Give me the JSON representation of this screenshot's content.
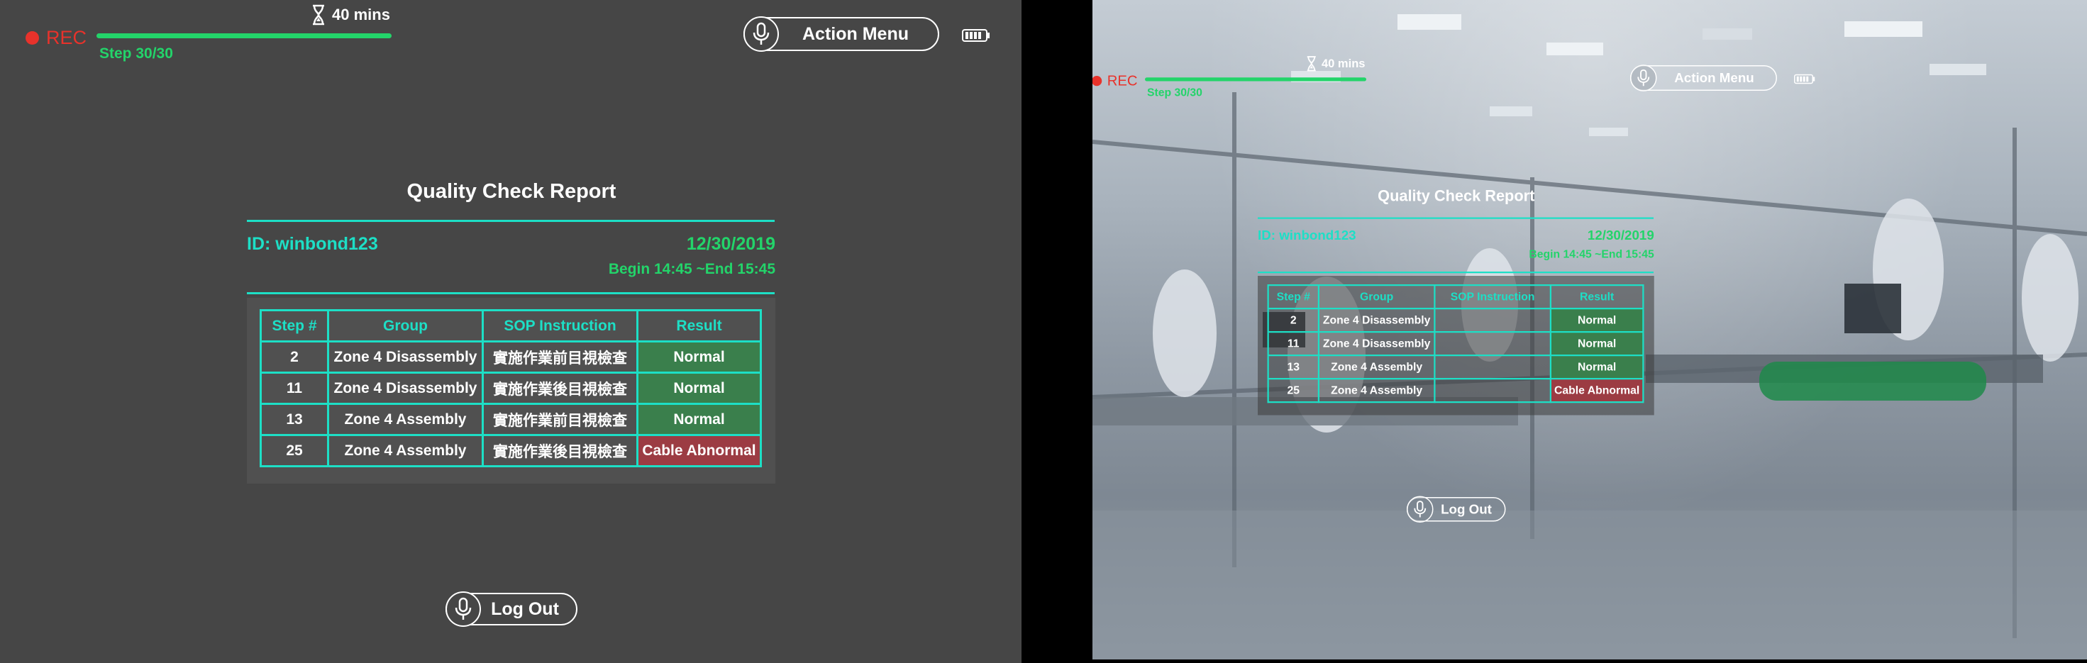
{
  "hud": {
    "rec_label": "REC",
    "timer_label": "40 mins",
    "step_label": "Step 30/30",
    "progress_fraction": 1.0,
    "action_menu_label": "Action Menu",
    "logout_label": "Log Out",
    "icons": [
      "record-dot-icon",
      "hourglass-icon",
      "microphone-icon",
      "battery-icon"
    ]
  },
  "report": {
    "title": "Quality Check Report",
    "id_label": "ID: winbond123",
    "date": "12/30/2019",
    "time_range": "Begin 14:45 ~End 15:45",
    "columns": [
      "Step #",
      "Group",
      "SOP Instruction",
      "Result"
    ],
    "rows": [
      {
        "step": "2",
        "group": "Zone 4 Disassembly",
        "sop": "實施作業前目視檢查",
        "result": "Normal",
        "status": "normal"
      },
      {
        "step": "11",
        "group": "Zone 4 Disassembly",
        "sop": "實施作業後目視檢查",
        "result": "Normal",
        "status": "normal"
      },
      {
        "step": "13",
        "group": "Zone 4 Assembly",
        "sop": "實施作業前目視檢查",
        "result": "Normal",
        "status": "normal"
      },
      {
        "step": "25",
        "group": "Zone 4 Assembly",
        "sop": "實施作業後目視檢查",
        "result": "Cable Abnormal",
        "status": "abnormal"
      }
    ],
    "right_view_sop_visible": false
  },
  "colors": {
    "accent_cyan": "#1ddfc6",
    "accent_green": "#23d46a",
    "rec_red": "#e8322b",
    "normal_bg": "#3a7f4c",
    "abnormal_bg": "#9c3c43",
    "panel_gray": "#464646"
  }
}
